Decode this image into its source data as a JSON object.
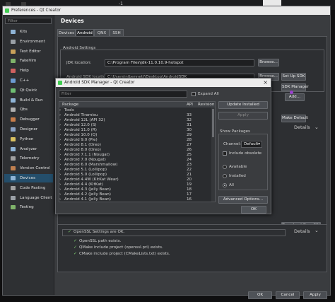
{
  "bg": {
    "label_minus": "-1"
  },
  "window": {
    "title": "Preferences - Qt Creator",
    "filter_placeholder": "Filter"
  },
  "sidebar": {
    "items": [
      {
        "label": "Kits",
        "color": "#8fb4d6"
      },
      {
        "label": "Environment",
        "color": "#9aa0a6"
      },
      {
        "label": "Text Editor",
        "color": "#c9a25a"
      },
      {
        "label": "FakeVim",
        "color": "#7fb36a"
      },
      {
        "label": "Help",
        "color": "#d06060"
      },
      {
        "label": "C++",
        "color": "#6c9bd2"
      },
      {
        "label": "Qt Quick",
        "color": "#6fbf73"
      },
      {
        "label": "Build & Run",
        "color": "#8fb4d6"
      },
      {
        "label": "Qbs",
        "color": "#b0b0b0"
      },
      {
        "label": "Debugger",
        "color": "#c77c4a"
      },
      {
        "label": "Designer",
        "color": "#8aa1c4"
      },
      {
        "label": "Python",
        "color": "#d8c060"
      },
      {
        "label": "Analyzer",
        "color": "#8fb4d6"
      },
      {
        "label": "Telemetry",
        "color": "#a0a0a0"
      },
      {
        "label": "Version Control",
        "color": "#c08050"
      },
      {
        "label": "Devices",
        "color": "#8fb4d6"
      },
      {
        "label": "Code Pasting",
        "color": "#a0a0a0"
      },
      {
        "label": "Language Client",
        "color": "#9aa0a6"
      },
      {
        "label": "Testing",
        "color": "#7fb36a"
      }
    ],
    "selected": "Devices"
  },
  "page": {
    "title": "Devices",
    "tabs": [
      "Devices",
      "Android",
      "QNX",
      "SSH"
    ],
    "active_tab": "Android",
    "android_settings_label": "Android Settings",
    "jdk_label": "JDK location:",
    "jdk_value": "C:\\Program Files\\jdk-11.0.10.9-hotspot",
    "sdk_label": "Android SDK location:",
    "sdk_value": "C:\\Users\\nibennett\\Desktop\\AndroidSDK",
    "browse1": "Browse...",
    "browse2": "Browse...",
    "setup_sdk": "Set Up SDK",
    "sdk_manager": "SDK Manager",
    "add": "Add...",
    "make_default": "Make Default",
    "details": "Details",
    "download_openssl": "Download OpenSSL",
    "details2": "Details",
    "status_header": "OpenSSL Settings are OK.",
    "status_items": [
      "OpenSSL path exists.",
      "QMake include project (openssl.pri) exists.",
      "CMake include project (CMakeLists.txt) exists."
    ],
    "ok": "OK",
    "cancel": "Cancel",
    "apply": "Apply"
  },
  "sdk_dialog": {
    "title": "Android SDK Manager - Qt Creator",
    "filter_placeholder": "Filter",
    "expand_all": "Expand All",
    "columns": [
      "Package",
      "API",
      "Revision"
    ],
    "rows": [
      {
        "name": "Tools",
        "api": "",
        "rev": ""
      },
      {
        "name": "Android Tiramisu",
        "api": "33",
        "rev": ""
      },
      {
        "name": "Android 12L (API 32)",
        "api": "32",
        "rev": ""
      },
      {
        "name": "Android 12.0 (S)",
        "api": "31",
        "rev": ""
      },
      {
        "name": "Android 11.0 (R)",
        "api": "30",
        "rev": ""
      },
      {
        "name": "Android 10.0 (Q)",
        "api": "29",
        "rev": ""
      },
      {
        "name": "Android 9.0 (Pie)",
        "api": "28",
        "rev": ""
      },
      {
        "name": "Android 8.1 (Oreo)",
        "api": "27",
        "rev": ""
      },
      {
        "name": "Android 8.0 (Oreo)",
        "api": "26",
        "rev": ""
      },
      {
        "name": "Android 7.1.1 (Nougat)",
        "api": "25",
        "rev": ""
      },
      {
        "name": "Android 7.0 (Nougat)",
        "api": "24",
        "rev": ""
      },
      {
        "name": "Android 6.0 (Marshmallow)",
        "api": "23",
        "rev": ""
      },
      {
        "name": "Android 5.1 (Lollipop)",
        "api": "22",
        "rev": ""
      },
      {
        "name": "Android 5.0 (Lollipop)",
        "api": "21",
        "rev": ""
      },
      {
        "name": "Android 4.4W (KitKat Wear)",
        "api": "20",
        "rev": ""
      },
      {
        "name": "Android 4.4 (KitKat)",
        "api": "19",
        "rev": ""
      },
      {
        "name": "Android 4.3 (Jelly Bean)",
        "api": "18",
        "rev": ""
      },
      {
        "name": "Android 4.2 (Jelly Bean)",
        "api": "17",
        "rev": ""
      },
      {
        "name": "Android 4.1 (Jelly Bean)",
        "api": "16",
        "rev": ""
      }
    ],
    "update_installed": "Update Installed",
    "apply": "Apply",
    "show_packages": "Show Packages",
    "channel_label": "Channel:",
    "channel_value": "Default",
    "include_obsolete": "Include obsolete",
    "radio_available": "Available",
    "radio_installed": "Installed",
    "radio_all": "All",
    "advanced_options": "Advanced Options...",
    "ok": "OK"
  }
}
